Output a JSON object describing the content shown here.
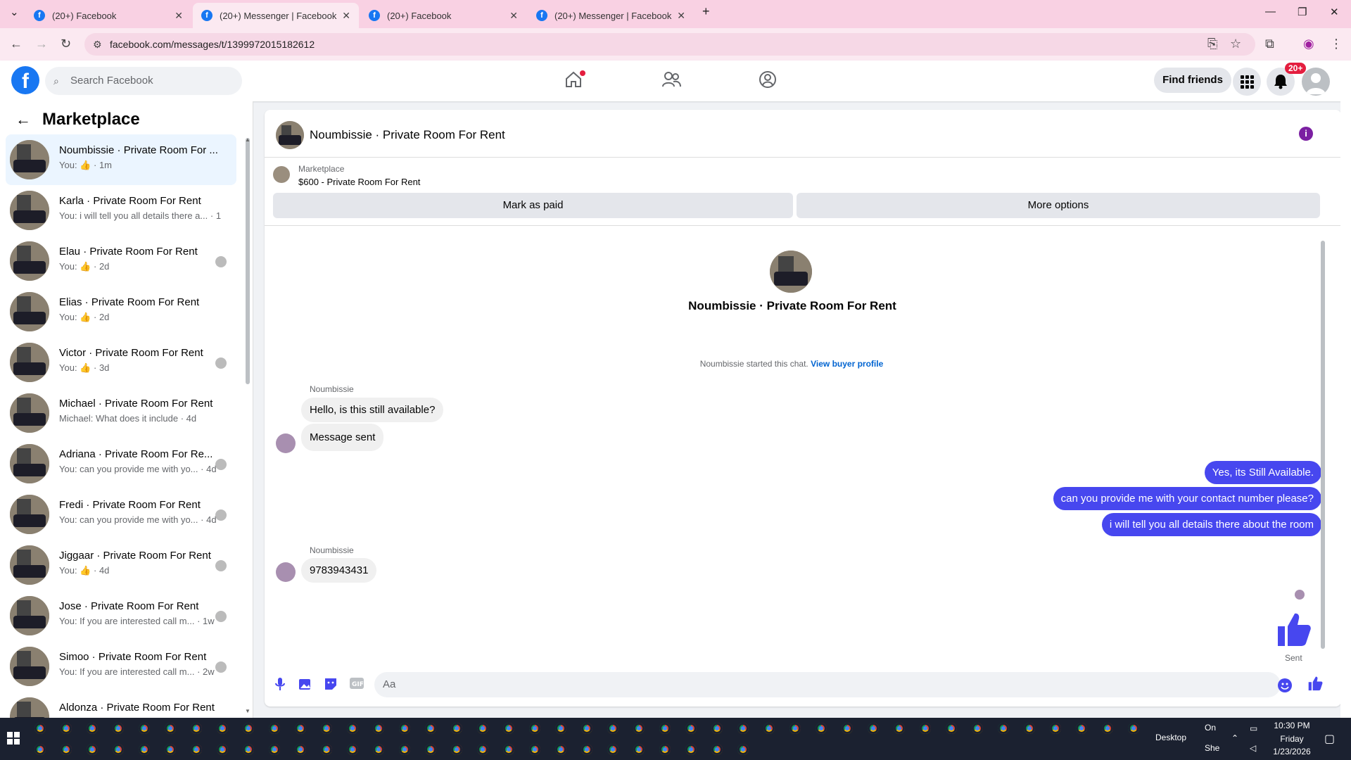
{
  "browser": {
    "tabs": [
      {
        "title": "(20+) Facebook",
        "active": false
      },
      {
        "title": "(20+) Messenger | Facebook",
        "active": true
      },
      {
        "title": "(20+) Facebook",
        "active": false
      },
      {
        "title": "(20+) Messenger | Facebook",
        "active": false
      }
    ],
    "url": "facebook.com/messages/t/1399972015182612"
  },
  "header": {
    "search_placeholder": "Search Facebook",
    "find_friends": "Find friends",
    "notification_badge": "20+"
  },
  "sidebar": {
    "title": "Marketplace",
    "conversations": [
      {
        "name": "Noumbissie · Private Room For ...",
        "preview": "You:",
        "time": "· 1m",
        "like": true,
        "active": true,
        "mini": false
      },
      {
        "name": "Karla · Private Room For Rent",
        "preview": "You: i will tell you all details there a...",
        "time": "· 1h",
        "like": false,
        "active": false,
        "mini": false
      },
      {
        "name": "Elau · Private Room For Rent",
        "preview": "You:",
        "time": "· 2d",
        "like": true,
        "active": false,
        "mini": true
      },
      {
        "name": "Elias · Private Room For Rent",
        "preview": "You:",
        "time": "· 2d",
        "like": true,
        "active": false,
        "mini": false
      },
      {
        "name": "Victor · Private Room For Rent",
        "preview": "You:",
        "time": "· 3d",
        "like": true,
        "active": false,
        "mini": true
      },
      {
        "name": "Michael · Private Room For Rent",
        "preview": "Michael: What does it include",
        "time": "· 4d",
        "like": false,
        "active": false,
        "mini": false
      },
      {
        "name": "Adriana · Private Room For Re...",
        "preview": "You: can you provide me with yo...",
        "time": "· 4d",
        "like": false,
        "active": false,
        "mini": true
      },
      {
        "name": "Fredi · Private Room For Rent",
        "preview": "You: can you provide me with yo...",
        "time": "· 4d",
        "like": false,
        "active": false,
        "mini": true
      },
      {
        "name": "Jiggaar · Private Room For Rent",
        "preview": "You:",
        "time": "· 4d",
        "like": true,
        "active": false,
        "mini": true
      },
      {
        "name": "Jose · Private Room For Rent",
        "preview": "You: If you are interested call m...",
        "time": "· 1w",
        "like": false,
        "active": false,
        "mini": true
      },
      {
        "name": "Simoo · Private Room For Rent",
        "preview": "You: If you are interested call m...",
        "time": "· 2w",
        "like": false,
        "active": false,
        "mini": true
      },
      {
        "name": "Aldonza · Private Room For Rent",
        "preview": "",
        "time": "",
        "like": false,
        "active": false,
        "mini": false
      }
    ]
  },
  "chat": {
    "title": "Noumbissie · Private Room For Rent",
    "marketplace_label": "Marketplace",
    "listing": "$600 - Private Room For Rent",
    "mark_paid": "Mark as paid",
    "more_options": "More options",
    "center_name": "Noumbissie · Private Room For Rent",
    "started_text": "Noumbissie started this chat.",
    "view_buyer": "View buyer profile",
    "sender_name": "Noumbissie",
    "msg_in_1": "Hello, is this still available?",
    "msg_in_2": "Message sent",
    "msg_out_1": "Yes, its Still Available.",
    "msg_out_2": "can you provide me with your contact number please?",
    "msg_out_3": "i will tell you all details there about the room",
    "sender_name_2": "Noumbissie",
    "msg_in_3": "9783943431",
    "sent_label": "Sent",
    "composer_placeholder": "Aa"
  },
  "taskbar": {
    "desktop_label": "Desktop",
    "onedrive_label": "On",
    "weather_label": "She",
    "time": "10:30 PM",
    "day": "Friday",
    "date": "1/23/2026"
  }
}
